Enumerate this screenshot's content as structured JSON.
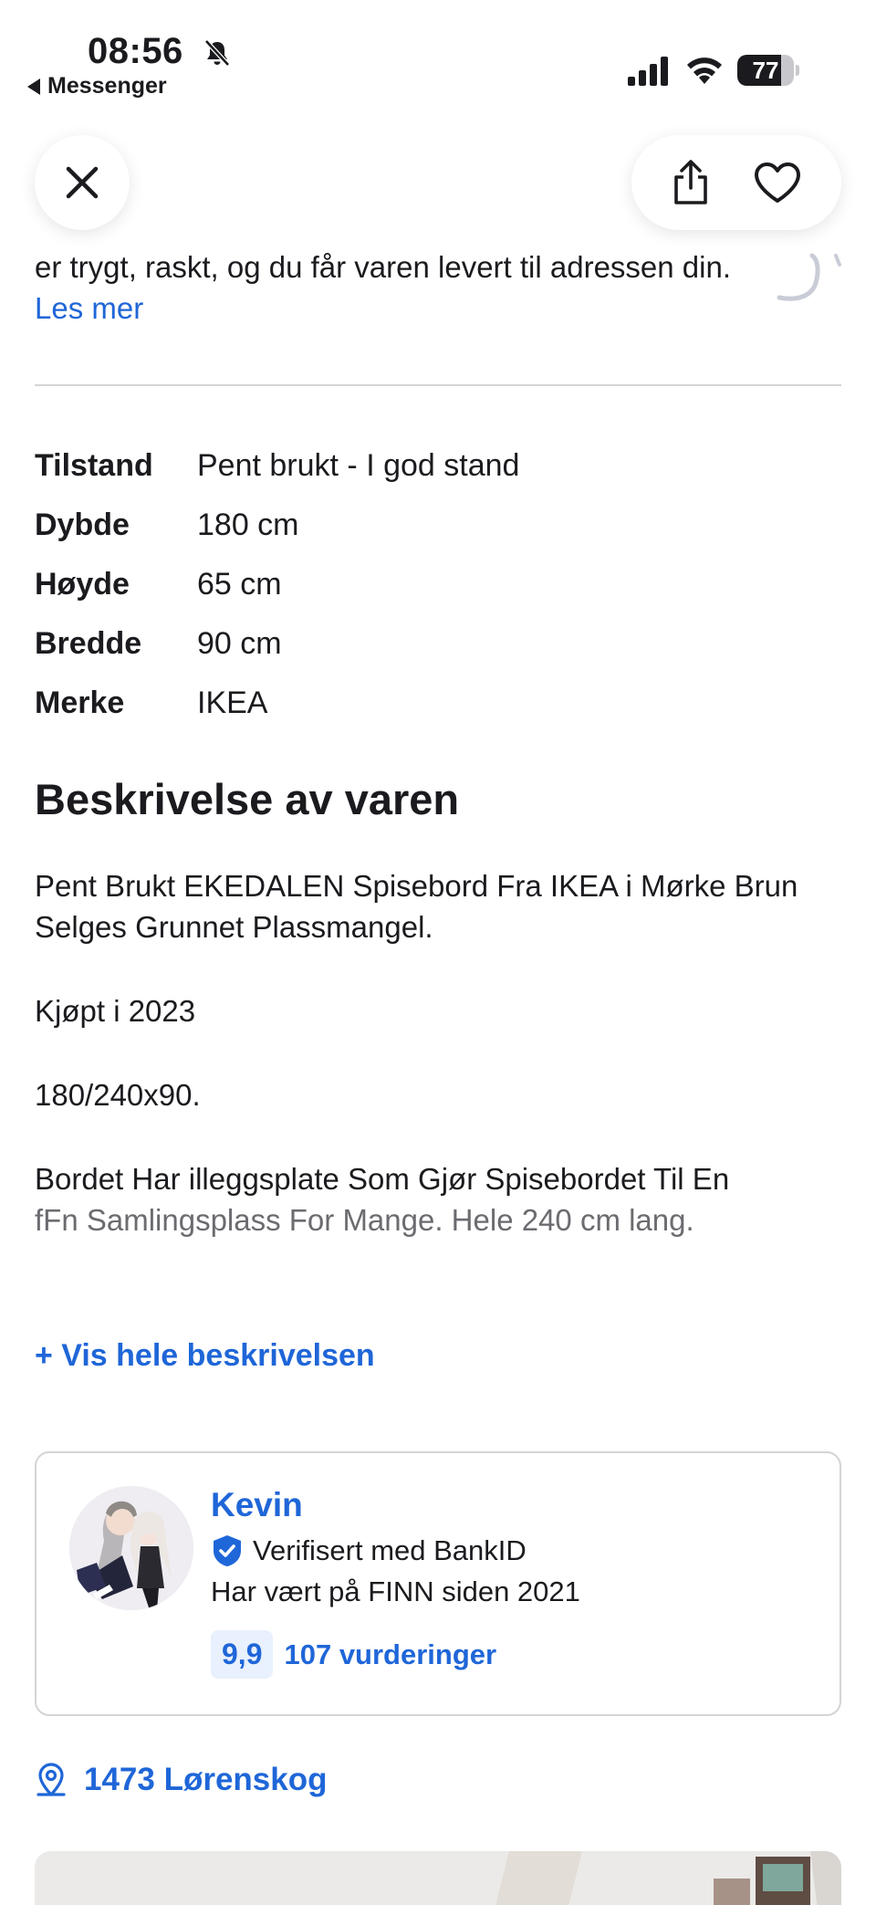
{
  "status_bar": {
    "time": "08:56",
    "back_app": "Messenger",
    "battery_level": 77,
    "battery_label": "77"
  },
  "header": {
    "close_icon": "close-icon",
    "share_icon": "share-icon",
    "favorite_icon": "heart-icon"
  },
  "intro": {
    "text": "er trygt, raskt, og du får varen levert til adressen din.",
    "link": "Les mer"
  },
  "specs": [
    {
      "key": "Tilstand",
      "value": "Pent brukt - I god stand"
    },
    {
      "key": "Dybde",
      "value": "180 cm"
    },
    {
      "key": "Høyde",
      "value": "65 cm"
    },
    {
      "key": "Bredde",
      "value": "90 cm"
    },
    {
      "key": "Merke",
      "value": "IKEA"
    }
  ],
  "description": {
    "heading": "Beskrivelse av varen",
    "paragraphs": [
      "Pent Brukt EKEDALEN Spisebord Fra IKEA i Mørke Brun Selges Grunnet Plassmangel.",
      "Kjøpt i 2023",
      "180/240x90.",
      "Bordet Har illeggsplate Som Gjør Spisebordet Til En",
      "fFn Samlingsplass For Mange. Hele 240 cm lang."
    ],
    "show_more": "+ Vis hele beskrivelsen"
  },
  "seller": {
    "name": "Kevin",
    "verified": "Verifisert med BankID",
    "member_since": "Har vært på FINN siden 2021",
    "rating": "9,9",
    "rating_count": "107 vurderinger"
  },
  "location": {
    "text": "1473 Lørenskog"
  },
  "colors": {
    "accent": "#1f66d8",
    "text": "#1b1b1f",
    "divider": "#d4d4d8"
  }
}
